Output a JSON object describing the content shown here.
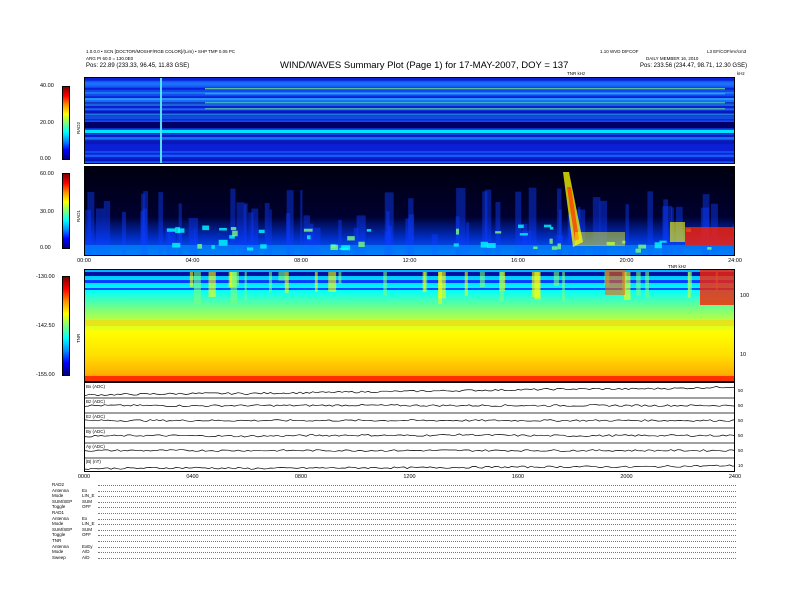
{
  "header": {
    "left_line1": "1.0.0.0 • SCN [DOCTOR/MOSHF/RGB COLOR]/(Lim) • SHP TMP 0.05 PC",
    "left_line2": "ARG PI 60.0 = 130.0E0",
    "left_line3": "Pos:    22.89 (233.33, 96.45, 11.83 GSE)",
    "title": "WIND/WAVES Summary Plot (Page 1) for 17-MAY-2007, DOY = 137",
    "right_line1": "1.10 WVD DIFCOF",
    "right_line1b": "L3 EF/COF/eV/cm3",
    "right_line2": "DAILY MEMBER 16, 2010",
    "right_line3": "Pos:    233.56 (234.47, 98.71, 12.30 GSE)",
    "right_units_label": "kHz",
    "tnr_mid_label": "TNR kHz",
    "rad_units": "TNR kHz"
  },
  "colors": {
    "colormap": [
      "#00007f",
      "#0000ff",
      "#0090ff",
      "#00ffff",
      "#7dff7a",
      "#ffff00",
      "#ff9000",
      "#ff0000",
      "#7f0000"
    ],
    "frame": "#000000"
  },
  "chart_data": [
    {
      "type": "heatmap",
      "name": "RAD2",
      "ylabel": "RAD2",
      "yticks": [
        "40.00",
        "20.00",
        "0.00"
      ],
      "cbar_ticks": [
        "40.00",
        "20.00",
        "0.00"
      ],
      "xlim": [
        0,
        24
      ]
    },
    {
      "type": "heatmap",
      "name": "RAD1",
      "ylabel": "RAD1",
      "yticks": [
        "60.00",
        "30.00",
        "0.00"
      ],
      "cbar_ticks": [
        "60.00",
        "30.00",
        "0.00"
      ],
      "xticks": [
        "00:00",
        "04:00",
        "08:00",
        "12:00",
        "16:00",
        "20:00",
        "24:00"
      ],
      "xlim": [
        0,
        24
      ]
    },
    {
      "type": "heatmap",
      "name": "TNR",
      "ylabel": "TNR",
      "yticks": [
        "-130.00",
        "-142.50",
        "-155.00"
      ],
      "cbar_ticks": [
        "-130.00",
        "-142.50",
        "-155.00"
      ],
      "right_ticks": [
        "100",
        "10"
      ],
      "xlim": [
        0,
        24
      ]
    },
    {
      "type": "line",
      "name": "stacked-parameters",
      "xticks": [
        "0000",
        "0400",
        "0800",
        "1200",
        "1600",
        "2000",
        "2400"
      ],
      "xlim": [
        0,
        24
      ],
      "series": [
        {
          "name": "Bx (ADC)",
          "x": [
            0,
            2,
            4,
            6,
            8,
            10,
            12,
            14,
            16,
            18,
            20,
            22,
            24
          ],
          "y": [
            0.2,
            0.25,
            0.3,
            0.3,
            0.35,
            0.4,
            0.45,
            0.5,
            0.55,
            0.6,
            0.6,
            0.65,
            0.75
          ],
          "right_tick": "50"
        },
        {
          "name": "Bz (ADC)",
          "x": [
            0,
            2,
            4,
            6,
            8,
            10,
            12,
            14,
            16,
            18,
            20,
            22,
            24
          ],
          "y": [
            0.5,
            0.5,
            0.48,
            0.5,
            0.5,
            0.52,
            0.5,
            0.5,
            0.5,
            0.5,
            0.5,
            0.5,
            0.5
          ],
          "right_tick": "50"
        },
        {
          "name": "Ez (ADC)",
          "x": [
            0,
            2,
            4,
            6,
            8,
            10,
            12,
            14,
            16,
            18,
            20,
            22,
            24
          ],
          "y": [
            0.5,
            0.5,
            0.5,
            0.5,
            0.5,
            0.5,
            0.5,
            0.5,
            0.5,
            0.5,
            0.5,
            0.5,
            0.5
          ],
          "right_tick": "50"
        },
        {
          "name": "By (ADC)",
          "x": [
            0,
            2,
            4,
            6,
            8,
            10,
            12,
            14,
            16,
            18,
            20,
            22,
            24
          ],
          "y": [
            0.45,
            0.5,
            0.48,
            0.45,
            0.5,
            0.52,
            0.5,
            0.55,
            0.5,
            0.48,
            0.5,
            0.5,
            0.5
          ],
          "right_tick": "50"
        },
        {
          "name": "Ay (ADC)",
          "x": [
            0,
            2,
            4,
            6,
            8,
            10,
            12,
            14,
            16,
            18,
            20,
            22,
            24
          ],
          "y": [
            0.5,
            0.5,
            0.5,
            0.5,
            0.5,
            0.5,
            0.5,
            0.5,
            0.5,
            0.5,
            0.5,
            0.5,
            0.5
          ],
          "right_tick": "50"
        },
        {
          "name": "|B| (nT)",
          "x": [
            0,
            2,
            4,
            6,
            8,
            10,
            12,
            14,
            16,
            18,
            20,
            22,
            24
          ],
          "y": [
            0.3,
            0.32,
            0.35,
            0.3,
            0.33,
            0.35,
            0.35,
            0.38,
            0.4,
            0.42,
            0.4,
            0.45,
            0.5
          ],
          "right_tick": "10"
        }
      ]
    }
  ],
  "info_block": {
    "rows": [
      {
        "k": "RAD2",
        "v": ""
      },
      {
        "k": "Antenna",
        "v": "Ex"
      },
      {
        "k": "Mode",
        "v": "LIN_E"
      },
      {
        "k": "SUM/SEP",
        "v": "SUM"
      },
      {
        "k": "Toggle",
        "v": "OFF"
      },
      {
        "k": "RAD1",
        "v": ""
      },
      {
        "k": "Antenna",
        "v": "Ex"
      },
      {
        "k": "Mode",
        "v": "LIN_E"
      },
      {
        "k": "SUM/SEP",
        "v": "SUM"
      },
      {
        "k": "Toggle",
        "v": "OFF"
      },
      {
        "k": "TNR",
        "v": ""
      },
      {
        "k": "Antenna",
        "v": "ExEy"
      },
      {
        "k": "Mode",
        "v": "A/D"
      },
      {
        "k": "Sweep",
        "v": "A/D"
      }
    ]
  }
}
